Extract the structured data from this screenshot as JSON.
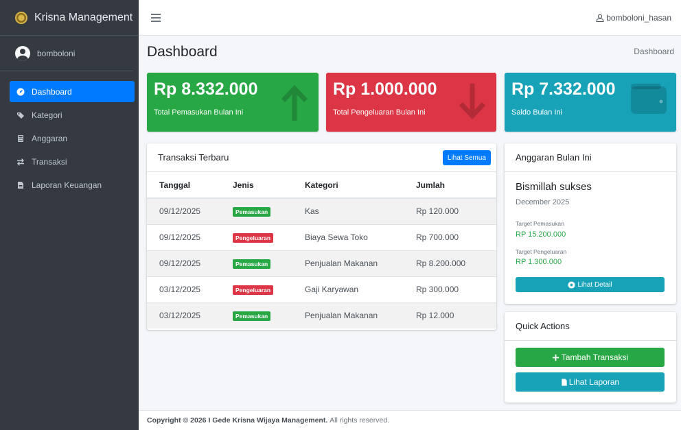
{
  "brand": {
    "name": "Krisna Management"
  },
  "user": {
    "name": "bomboloni",
    "top_name": "bomboloni_hasan"
  },
  "sidebar": {
    "items": [
      {
        "label": "Dashboard",
        "icon": "dashboard-icon",
        "active": true
      },
      {
        "label": "Kategori",
        "icon": "tag-icon"
      },
      {
        "label": "Anggaran",
        "icon": "calculator-icon"
      },
      {
        "label": "Transaksi",
        "icon": "exchange-icon"
      },
      {
        "label": "Laporan Keuangan",
        "icon": "file-icon"
      }
    ]
  },
  "header": {
    "title": "Dashboard",
    "breadcrumb": "Dashboard"
  },
  "stats": {
    "income": {
      "value": "Rp 8.332.000",
      "label": "Total Pemasukan Bulan Ini",
      "color": "#28a745"
    },
    "expense": {
      "value": "Rp 1.000.000",
      "label": "Total Pengeluaran Bulan Ini",
      "color": "#dc3545"
    },
    "balance": {
      "value": "Rp 7.332.000",
      "label": "Saldo Bulan Ini",
      "color": "#17a2b8"
    }
  },
  "transactions": {
    "title": "Transaksi Terbaru",
    "view_all": "Lihat Semua",
    "columns": [
      "Tanggal",
      "Jenis",
      "Kategori",
      "Jumlah"
    ],
    "rows": [
      {
        "date": "09/12/2025",
        "type": "Pemasukan",
        "category": "Kas",
        "amount": "Rp 120.000"
      },
      {
        "date": "09/12/2025",
        "type": "Pengeluaran",
        "category": "Biaya Sewa Toko",
        "amount": "Rp 700.000"
      },
      {
        "date": "09/12/2025",
        "type": "Pemasukan",
        "category": "Penjualan Makanan",
        "amount": "Rp 8.200.000"
      },
      {
        "date": "03/12/2025",
        "type": "Pengeluaran",
        "category": "Gaji Karyawan",
        "amount": "Rp 300.000"
      },
      {
        "date": "03/12/2025",
        "type": "Pemasukan",
        "category": "Penjualan Makanan",
        "amount": "Rp 12.000"
      }
    ]
  },
  "budget": {
    "title": "Anggaran Bulan Ini",
    "name": "Bismillah sukses",
    "period": "December 2025",
    "income_label": "Target Pemasukan",
    "income_value": "RP 15.200.000",
    "expense_label": "Target Pengeluaran",
    "expense_value": "RP 1.300.000",
    "detail_button": "Lihat Detail"
  },
  "quick": {
    "title": "Quick Actions",
    "add_button": "Tambah Transaksi",
    "report_button": "Lihat Laporan"
  },
  "footer": {
    "prefix": "Copyright © 2026",
    "company": "I Gede Krisna Wijaya Management.",
    "suffix": "All rights reserved."
  }
}
